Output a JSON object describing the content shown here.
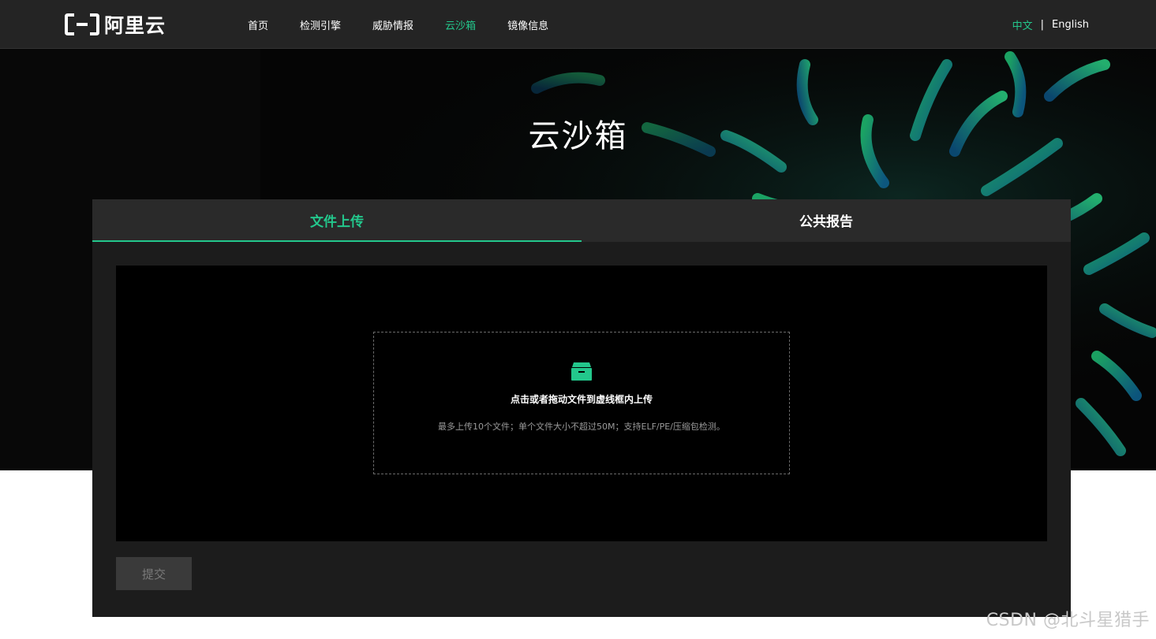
{
  "header": {
    "logo_text": "阿里云",
    "nav": [
      {
        "label": "首页",
        "active": false
      },
      {
        "label": "检测引擎",
        "active": false
      },
      {
        "label": "威胁情报",
        "active": false
      },
      {
        "label": "云沙箱",
        "active": true
      },
      {
        "label": "镜像信息",
        "active": false
      }
    ],
    "lang": {
      "zh": "中文",
      "separator": "|",
      "en": "English"
    }
  },
  "hero": {
    "title": "云沙箱"
  },
  "panel": {
    "tabs": [
      {
        "label": "文件上传",
        "active": true
      },
      {
        "label": "公共报告",
        "active": false
      }
    ],
    "upload": {
      "icon": "inbox-icon",
      "main_text": "点击或者拖动文件到虚线框内上传",
      "hint_text": "最多上传10个文件；单个文件大小不超过50M；支持ELF/PE/压缩包检测。"
    },
    "submit_label": "提交"
  },
  "watermark": "CSDN @北斗星猎手",
  "colors": {
    "accent": "#23c78c",
    "header_bg": "#242424",
    "panel_bg": "#1c1c1c",
    "tabbar_bg": "#2a2a2a"
  }
}
